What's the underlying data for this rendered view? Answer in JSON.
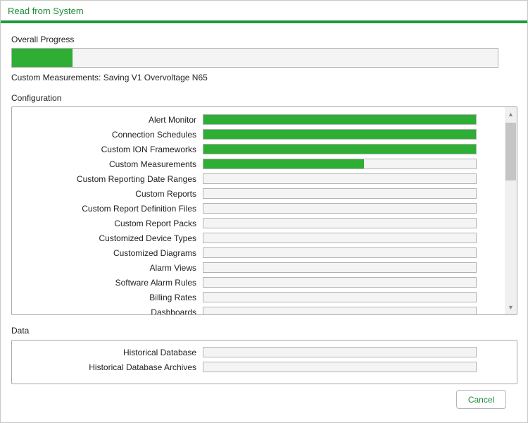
{
  "window": {
    "title": "Read from System"
  },
  "overall": {
    "label": "Overall Progress",
    "progress": 0.125,
    "status": "Custom Measurements: Saving V1 Overvoltage N65"
  },
  "configuration": {
    "label": "Configuration",
    "items": [
      {
        "label": "Alert Monitor",
        "progress": 1.0
      },
      {
        "label": "Connection Schedules",
        "progress": 1.0
      },
      {
        "label": "Custom ION Frameworks",
        "progress": 1.0
      },
      {
        "label": "Custom Measurements",
        "progress": 0.59
      },
      {
        "label": "Custom Reporting Date Ranges",
        "progress": 0
      },
      {
        "label": "Custom Reports",
        "progress": 0
      },
      {
        "label": "Custom Report Definition Files",
        "progress": 0
      },
      {
        "label": "Custom Report Packs",
        "progress": 0
      },
      {
        "label": "Customized Device Types",
        "progress": 0
      },
      {
        "label": "Customized Diagrams",
        "progress": 0
      },
      {
        "label": "Alarm Views",
        "progress": 0
      },
      {
        "label": "Software Alarm Rules",
        "progress": 0
      },
      {
        "label": "Billing Rates",
        "progress": 0
      },
      {
        "label": "Dashboards",
        "progress": 0
      }
    ]
  },
  "data_section": {
    "label": "Data",
    "items": [
      {
        "label": "Historical Database",
        "progress": 0
      },
      {
        "label": "Historical Database Archives",
        "progress": 0
      }
    ]
  },
  "buttons": {
    "cancel": "Cancel"
  },
  "colors": {
    "accent": "#1e9b3c",
    "progress_fill": "#2eae34",
    "track": "#f4f4f4"
  },
  "icons": {
    "scroll_up": "chevron-up-icon",
    "scroll_down": "chevron-down-icon"
  }
}
